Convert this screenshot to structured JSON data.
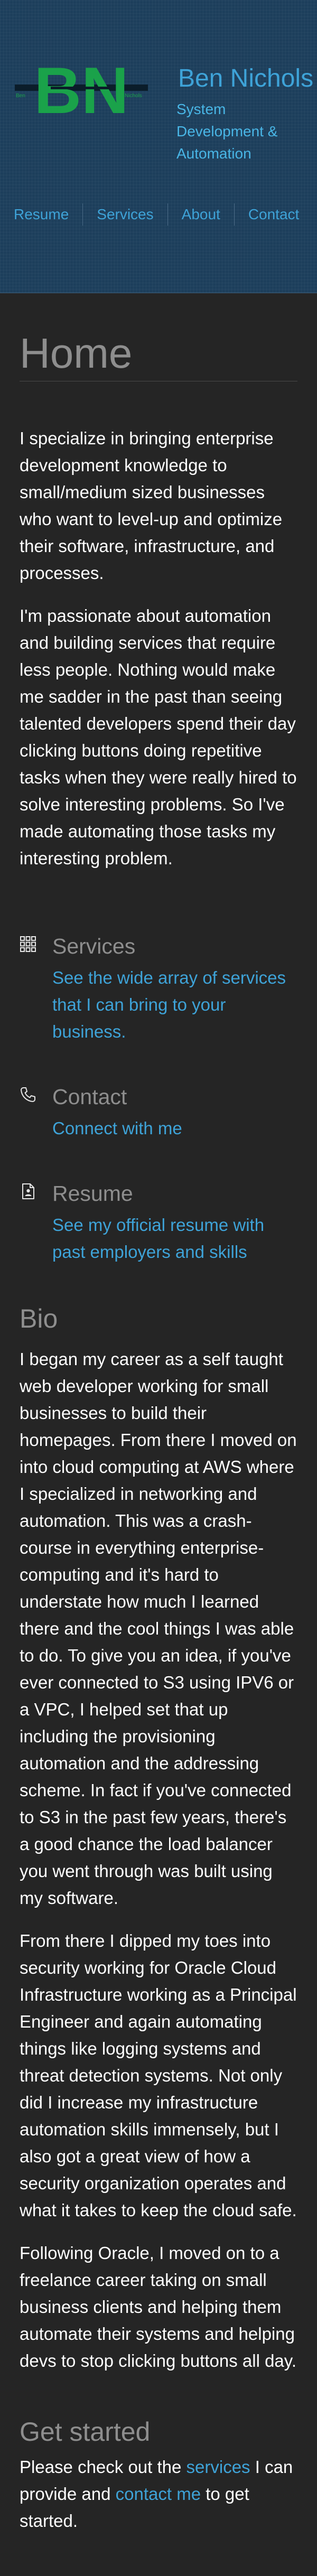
{
  "brand": {
    "name": "Ben Nichols",
    "tagline": "System Development & Automation",
    "logo": {
      "letters": "BN",
      "left_text": "Ben",
      "right_text": "Nichols",
      "color": "#1aa24a",
      "bar_color": "#0b1d2a"
    }
  },
  "nav": {
    "items": [
      {
        "label": "Resume"
      },
      {
        "label": "Services"
      },
      {
        "label": "About"
      },
      {
        "label": "Contact"
      }
    ]
  },
  "page": {
    "title": "Home",
    "intro": [
      "I specialize in bringing enterprise development knowledge to small/medium sized businesses who want to level-up and optimize their software, infrastructure, and processes.",
      "I'm passionate about automation and building services that require less people. Nothing would make me sadder in the past than seeing talented developers spend their day clicking buttons doing repetitive tasks when they were really hired to solve interesting problems. So I've made automating those tasks my interesting problem."
    ]
  },
  "features": [
    {
      "icon": "grid-icon",
      "title": "Services",
      "link": "See the wide array of services that I can bring to your business."
    },
    {
      "icon": "phone-icon",
      "title": "Contact",
      "link": "Connect with me"
    },
    {
      "icon": "document-icon",
      "title": "Resume",
      "link": "See my official resume with past employers and skills"
    }
  ],
  "bio": {
    "title": "Bio",
    "paragraphs": [
      "I began my career as a self taught web developer working for small businesses to build their homepages. From there I moved on into cloud computing at AWS where I specialized in networking and automation. This was a crash-course in everything enterprise-computing and it's hard to understate how much I learned there and the cool things I was able to do. To give you an idea, if you've ever connected to S3 using IPV6 or a VPC, I helped set that up including the provisioning automation and the addressing scheme. In fact if you've connected to S3 in the past few years, there's a good chance the load balancer you went through was built using my software.",
      "From there I dipped my toes into security working for Oracle Cloud Infrastructure working as a Principal Engineer and again automating things like logging systems and threat detection systems. Not only did I increase my infrastructure automation skills immensely, but I also got a great view of how a security organization operates and what it takes to keep the cloud safe.",
      "Following Oracle, I moved on to a freelance career taking on small business clients and helping them automate their systems and helping devs to stop clicking buttons all day."
    ]
  },
  "get_started": {
    "title": "Get started",
    "text_before": "Please check out the ",
    "services_link": "services",
    "text_middle": " I can provide and ",
    "contact_link": "contact me",
    "text_after": " to get started."
  },
  "colors": {
    "accent": "#3ea3d8",
    "header_bg": "#1d3f5c",
    "page_bg": "#252525",
    "muted_heading": "#8e8e8e"
  }
}
